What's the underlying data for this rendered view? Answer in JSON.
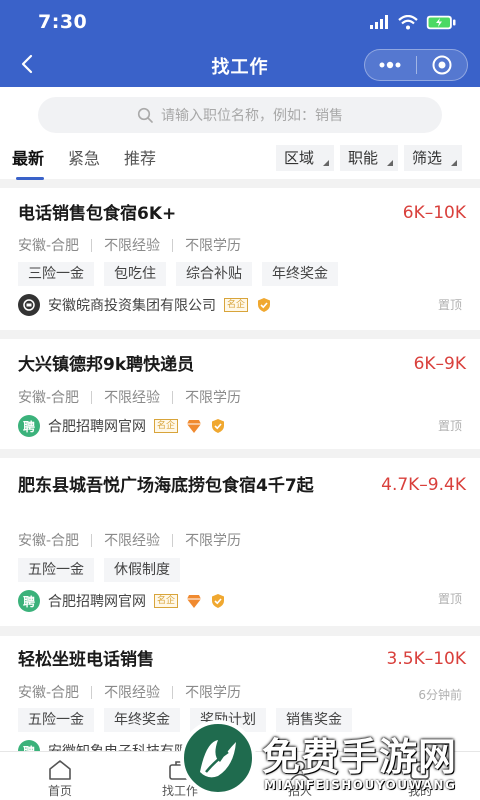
{
  "status": {
    "time": "7:30"
  },
  "nav": {
    "title": "找工作"
  },
  "search": {
    "placeholder": "请输入职位名称，例如：销售"
  },
  "tabs": [
    {
      "label": "最新",
      "active": true
    },
    {
      "label": "紧急",
      "active": false
    },
    {
      "label": "推荐",
      "active": false
    }
  ],
  "filters": [
    "区域",
    "职能",
    "筛选"
  ],
  "colors": {
    "brand": "#3a62c9",
    "salary": "#d9403c",
    "tag_bg": "#f4f5f7",
    "page_bg": "#f2f2f2"
  },
  "jobs": [
    {
      "title": "电话销售包食宿6K+",
      "salary": "6K–10K",
      "meta": [
        "安徽-合肥",
        "不限经验",
        "不限学历"
      ],
      "tags": [
        "三险一金",
        "包吃住",
        "综合补贴",
        "年终奖金"
      ],
      "company": "安徽皖商投资集团有限公司",
      "company_badge": "名企",
      "side_label": "置顶",
      "logo_icon": "company-logo-icon"
    },
    {
      "title": "大兴镇德邦9k聘快递员",
      "salary": "6K–9K",
      "meta": [
        "安徽-合肥",
        "不限经验",
        "不限学历"
      ],
      "tags": [],
      "company": "合肥招聘网官网",
      "company_badge": "名企",
      "logo_text": "聘",
      "side_label": "置顶"
    },
    {
      "title": "肥东县城吾悦广场海底捞包食宿4千7起",
      "salary": "4.7K–9.4K",
      "meta": [
        "安徽-合肥",
        "不限经验",
        "不限学历"
      ],
      "tags": [
        "五险一金",
        "休假制度"
      ],
      "company": "合肥招聘网官网",
      "company_badge": "名企",
      "logo_text": "聘",
      "side_label": "置顶"
    },
    {
      "title": "轻松坐班电话销售",
      "salary": "3.5K–10K",
      "meta": [
        "安徽-合肥",
        "不限经验",
        "不限学历"
      ],
      "tags": [
        "五险一金",
        "年终奖金",
        "奖励计划",
        "销售奖金"
      ],
      "company": "安徽知象电子科技有限公司",
      "logo_text": "聘",
      "side_label": "6分钟前"
    }
  ],
  "tabbar": [
    {
      "label": "首页",
      "icon": "home-icon"
    },
    {
      "label": "找工作",
      "icon": "briefcase-icon"
    },
    {
      "label": "招人",
      "icon": "person-icon"
    },
    {
      "label": "我的",
      "icon": "user-icon"
    }
  ],
  "watermark": {
    "title": "免费手游网",
    "subtitle": "MIANFEISHOUYOUWANG"
  }
}
